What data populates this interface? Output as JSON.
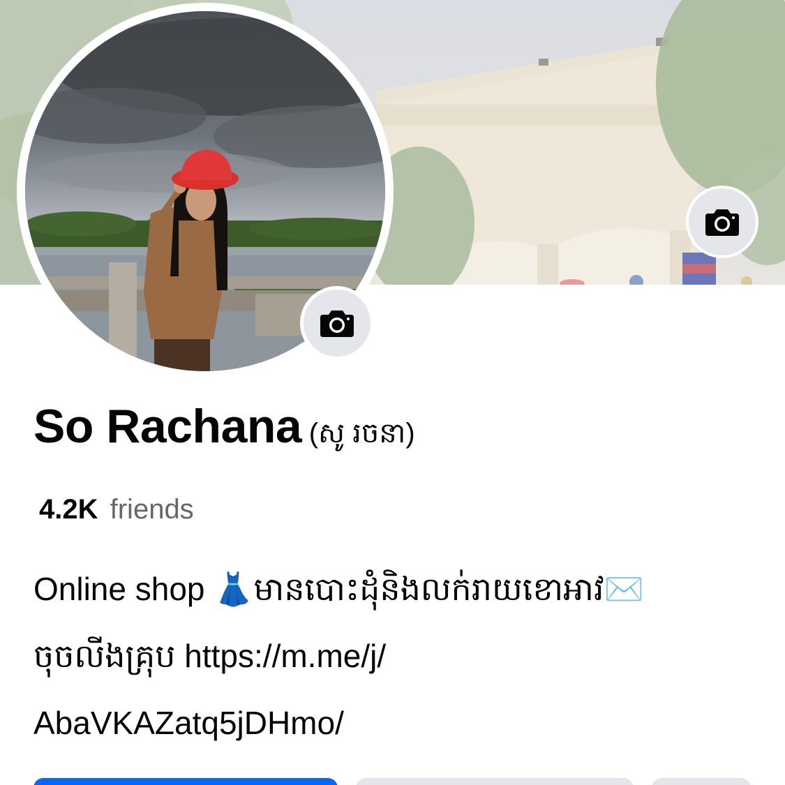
{
  "profile": {
    "name": "So Rachana",
    "alt_name": "(សូ រចនា)",
    "friends_count": "4.2K",
    "friends_label": "friends"
  },
  "bio": {
    "line1": "Online shop 👗មានបោះដុំនិងលក់រាយខោអាវ✉️",
    "line2": "ចុចលីងគ្រុប https://m.me/j/",
    "line3": "AbaVKAZatq5jDHmo/"
  },
  "icons": {
    "cover_camera": "camera-icon",
    "avatar_camera": "camera-icon"
  },
  "colors": {
    "primary_button": "#0866ff",
    "secondary_button": "#e4e6eb",
    "muted_text": "#65676b"
  }
}
